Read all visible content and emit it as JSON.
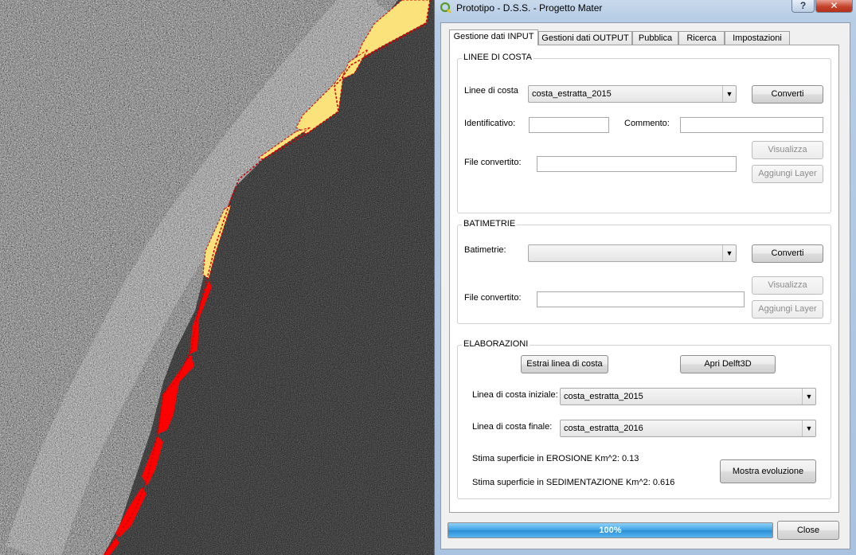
{
  "window": {
    "title": "Prototipo - D.S.S. - Progetto Mater",
    "help_label": "?",
    "close_label": "✕"
  },
  "tabs": [
    {
      "label": "Gestione dati INPUT"
    },
    {
      "label": "Gestioni dati OUTPUT"
    },
    {
      "label": "Pubblica"
    },
    {
      "label": "Ricerca"
    },
    {
      "label": "Impostazioni"
    }
  ],
  "linee": {
    "title": "LINEE DI COSTA",
    "linee_label": "Linee di costa",
    "linee_value": "costa_estratta_2015",
    "converti_label": "Converti",
    "identificativo_label": "Identificativo:",
    "identificativo_value": "",
    "commento_label": "Commento:",
    "commento_value": "",
    "file_label": "File convertito:",
    "file_value": "",
    "visualizza_label": "Visualizza",
    "aggiungi_label": "Aggiungi Layer"
  },
  "batimetrie": {
    "title": "BATIMETRIE",
    "batimetrie_label": "Batimetrie:",
    "batimetrie_value": "",
    "converti_label": "Converti",
    "file_label": "File convertito:",
    "file_value": "",
    "visualizza_label": "Visualizza",
    "aggiungi_label": "Aggiungi Layer"
  },
  "elaborazioni": {
    "title": "ELABORAZIONI",
    "estrai_label": "Estrai linea di costa",
    "delft_label": "Apri Delft3D",
    "iniziale_label": "Linea di costa iniziale:",
    "iniziale_value": "costa_estratta_2015",
    "finale_label": "Linea di costa finale:",
    "finale_value": "costa_estratta_2016",
    "erosione_text": "Stima  superficie in EROSIONE Km^2: 0.13",
    "sedimentazione_text": "Stima superficie in SEDIMENTAZIONE Km^2: 0.616",
    "mostra_label": "Mostra evoluzione"
  },
  "footer": {
    "progress_value": 1.0,
    "progress_text": "100%",
    "close_label": "Close"
  },
  "colors": {
    "erosion": "#ff0000",
    "sedimentation": "#fbe27a",
    "progress": "#3aa0e3"
  }
}
